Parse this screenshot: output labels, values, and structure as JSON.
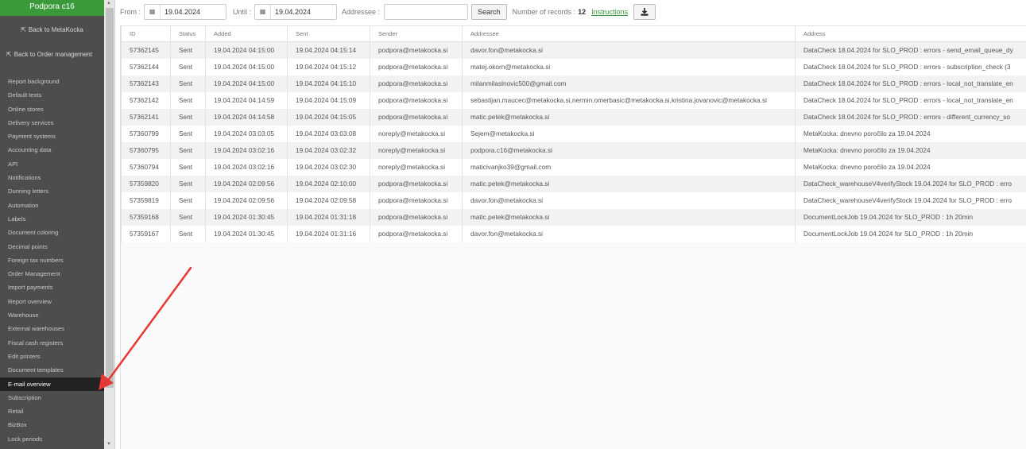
{
  "sidebar": {
    "brand": "Podpora c16",
    "back_metakocka": "Back to MetaKocka",
    "back_order": "Back to Order management",
    "items": [
      {
        "label": "Report background"
      },
      {
        "label": "Default texts"
      },
      {
        "label": "Online stores"
      },
      {
        "label": "Delivery services"
      },
      {
        "label": "Payment systems"
      },
      {
        "label": "Accounting data"
      },
      {
        "label": "API"
      },
      {
        "label": "Notifications"
      },
      {
        "label": "Dunning letters"
      },
      {
        "label": "Automation"
      },
      {
        "label": "Labels"
      },
      {
        "label": "Document coloring"
      },
      {
        "label": "Decimal points"
      },
      {
        "label": "Foreign tax numbers"
      },
      {
        "label": "Order Management"
      },
      {
        "label": "Import payments"
      },
      {
        "label": "Report overview"
      },
      {
        "label": "Warehouse"
      },
      {
        "label": "External warehouses"
      },
      {
        "label": "Fiscal cash registers"
      },
      {
        "label": "Edit printers"
      },
      {
        "label": "Document templates"
      },
      {
        "label": "E-mail overview",
        "active": true
      },
      {
        "label": "Subscription"
      },
      {
        "label": "Retail"
      },
      {
        "label": "BizBox"
      },
      {
        "label": "Lock periods"
      }
    ]
  },
  "toolbar": {
    "from_label": "From :",
    "from_value": "19.04.2024",
    "until_label": "Until :",
    "until_value": "19.04.2024",
    "addressee_label": "Addressee :",
    "addressee_value": "",
    "search_label": "Search",
    "records_label": "Number of records :",
    "records_count": "12",
    "instructions_label": "Instructions"
  },
  "table": {
    "columns": [
      "ID",
      "Status",
      "Added",
      "Sent",
      "Sender",
      "Addressee",
      "Address"
    ],
    "rows": [
      [
        "57362145",
        "Sent",
        "19.04.2024 04:15:00",
        "19.04.2024 04:15:14",
        "podpora@metakocka.si",
        "davor.fon@metakocka.si",
        "DataCheck 18.04.2024 for SLO_PROD : errors - send_email_queue_dy"
      ],
      [
        "57362144",
        "Sent",
        "19.04.2024 04:15:00",
        "19.04.2024 04:15:12",
        "podpora@metakocka.si",
        "matej.okorn@metakocka.si",
        "DataCheck 18.04.2024 for SLO_PROD : errors - subscription_check (3"
      ],
      [
        "57362143",
        "Sent",
        "19.04.2024 04:15:00",
        "19.04.2024 04:15:10",
        "podpora@metakocka.si",
        "milanmilaslnovic500@gmail.com",
        "DataCheck 18.04.2024 for SLO_PROD : errors - local_not_translate_en"
      ],
      [
        "57362142",
        "Sent",
        "19.04.2024 04:14:59",
        "19.04.2024 04:15:09",
        "podpora@metakocka.si",
        "sebastijan.maucec@metakocka.si,nermin.omerbasic@metakocka.si,kristina.jovanovic@metakocka.si",
        "DataCheck 18.04.2024 for SLO_PROD : errors - local_not_translate_en"
      ],
      [
        "57362141",
        "Sent",
        "19.04.2024 04:14:58",
        "19.04.2024 04:15:05",
        "podpora@metakocka.si",
        "matic.petek@metakocka.si",
        "DataCheck 18.04.2024 for SLO_PROD : errors - different_currency_so"
      ],
      [
        "57360799",
        "Sent",
        "19.04.2024 03:03:05",
        "19.04.2024 03:03:08",
        "noreply@metakocka.si",
        "Sejem@metakocka.si",
        "MetaKocka: dnevno poročilo za 19.04.2024"
      ],
      [
        "57360795",
        "Sent",
        "19.04.2024 03:02:16",
        "19.04.2024 03:02:32",
        "noreply@metakocka.si",
        "podpora.c16@metakocka.si",
        "MetaKocka: dnevno poročilo za 19.04.2024"
      ],
      [
        "57360794",
        "Sent",
        "19.04.2024 03:02:16",
        "19.04.2024 03:02:30",
        "noreply@metakocka.si",
        "maticivanjko39@gmail.com",
        "MetaKocka: dnevno poročilo za 19.04.2024"
      ],
      [
        "57359820",
        "Sent",
        "19.04.2024 02:09:56",
        "19.04.2024 02:10:00",
        "podpora@metakocka.si",
        "matic.petek@metakocka.si",
        "DataCheck_warehouseV4verifyStock 19.04.2024 for SLO_PROD : erro"
      ],
      [
        "57359819",
        "Sent",
        "19.04.2024 02:09:56",
        "19.04.2024 02:09:58",
        "podpora@metakocka.si",
        "davor.fon@metakocka.si",
        "DataCheck_warehouseV4verifyStock 19.04.2024 for SLO_PROD : erro"
      ],
      [
        "57359168",
        "Sent",
        "19.04.2024 01:30:45",
        "19.04.2024 01:31:18",
        "podpora@metakocka.si",
        "matic.petek@metakocka.si",
        "DocumentLockJob 19.04.2024 for SLO_PROD : 1h 20min"
      ],
      [
        "57359167",
        "Sent",
        "19.04.2024 01:30:45",
        "19.04.2024 01:31:16",
        "podpora@metakocka.si",
        "davor.fon@metakocka.si",
        "DocumentLockJob 19.04.2024 for SLO_PROD : 1h 20min"
      ]
    ]
  },
  "colors": {
    "brand": "#3a9a3a",
    "sidebar_bg": "#4d4d4d",
    "active_item_bg": "#222222",
    "arrow": "#e53935",
    "link": "#3a9a3a"
  },
  "icons": {
    "back": "external-link-icon",
    "calendar": "calendar-icon",
    "download": "download-icon"
  }
}
